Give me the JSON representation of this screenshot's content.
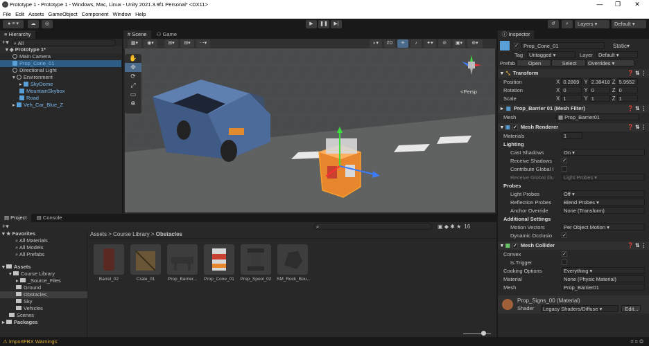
{
  "window": {
    "title": "Prototype 1 - Prototype 1 - Windows, Mac, Linux - Unity 2021.3.9f1 Personal* <DX11>",
    "minimize": "—",
    "restore": "❐",
    "close": "✕"
  },
  "menu": [
    "File",
    "Edit",
    "Assets",
    "GameObject",
    "Component",
    "Window",
    "Help"
  ],
  "toolbar": {
    "play": "▶",
    "pause": "❚❚",
    "step": "▶|",
    "layers": "Layers",
    "layout": "Default"
  },
  "hierarchy": {
    "tab": "Hierarchy",
    "search_placeholder": "All",
    "scene": "Prototype 1*",
    "items": [
      {
        "label": "Main Camera",
        "indent": 1
      },
      {
        "label": "Prop_Cone_01",
        "indent": 1,
        "selected": true
      },
      {
        "label": "Directional Light",
        "indent": 1
      },
      {
        "label": "Environment",
        "indent": 1
      },
      {
        "label": "SkyDome",
        "indent": 2
      },
      {
        "label": "MountainSkybox",
        "indent": 2
      },
      {
        "label": "Road",
        "indent": 2
      },
      {
        "label": "Veh_Car_Blue_Z",
        "indent": 1
      }
    ]
  },
  "scene_view": {
    "tabs": [
      "Scene",
      "Game"
    ],
    "mode_2d": "2D",
    "persp": "<Persp"
  },
  "project": {
    "tabs": [
      "Project",
      "Console"
    ],
    "breadcrumb": [
      "Assets",
      "Course Library",
      "Obstacles"
    ],
    "count": "16",
    "favorites": {
      "label": "Favorites",
      "items": [
        "All Materials",
        "All Models",
        "All Prefabs"
      ]
    },
    "assets_root": "Assets",
    "tree": [
      {
        "label": "Course Library",
        "indent": 1
      },
      {
        "label": "_Source_Files",
        "indent": 2
      },
      {
        "label": "Ground",
        "indent": 2
      },
      {
        "label": "Obstacles",
        "indent": 2,
        "selected": true
      },
      {
        "label": "Sky",
        "indent": 2
      },
      {
        "label": "Vehicles",
        "indent": 2
      },
      {
        "label": "Scenes",
        "indent": 1
      }
    ],
    "packages": "Packages",
    "assets": [
      "Barrel_02",
      "Crate_01",
      "Prop_Barrier...",
      "Prop_Cone_01",
      "Prop_Spool_02",
      "SM_Rock_Bou..."
    ]
  },
  "status": {
    "warning": "ImportFBX Warnings:"
  },
  "inspector": {
    "tab": "Inspector",
    "object_name": "Prop_Cone_01",
    "static": "Static",
    "tag_label": "Tag",
    "tag": "Untagged",
    "layer_label": "Layer",
    "layer": "Default",
    "prefab_label": "Prefab",
    "prefab_open": "Open",
    "prefab_select": "Select",
    "prefab_overrides": "Overrides",
    "transform": {
      "title": "Transform",
      "position": {
        "label": "Position",
        "x": "0.2869",
        "y": "2.38418",
        "z": "5.9552"
      },
      "rotation": {
        "label": "Rotation",
        "x": "0",
        "y": "0",
        "z": "0"
      },
      "scale": {
        "label": "Scale",
        "x": "1",
        "y": "1",
        "z": "1"
      }
    },
    "mesh_filter": {
      "title": "Prop_Barrier 01 (Mesh Filter)",
      "mesh_label": "Mesh",
      "mesh": "Prop_Barrier01"
    },
    "mesh_renderer": {
      "title": "Mesh Renderer",
      "materials_label": "Materials",
      "materials_count": "1",
      "lighting": "Lighting",
      "cast_shadows_label": "Cast Shadows",
      "cast_shadows": "On",
      "receive_shadows_label": "Receive Shadows",
      "contribute_gi_label": "Contribute Global I",
      "receive_gi_label": "Receive Global Illu",
      "receive_gi": "Light Probes",
      "probes": "Probes",
      "light_probes_label": "Light Probes",
      "light_probes": "Off",
      "reflection_probes_label": "Reflection Probes",
      "reflection_probes": "Blend Probes",
      "anchor_override_label": "Anchor Override",
      "anchor_override": "None (Transform)",
      "additional": "Additional Settings",
      "motion_vectors_label": "Motion Vectors",
      "motion_vectors": "Per Object Motion",
      "dynamic_occlusion_label": "Dynamic Occlusio"
    },
    "mesh_collider": {
      "title": "Mesh Collider",
      "convex_label": "Convex",
      "is_trigger_label": "Is Trigger",
      "cooking_label": "Cooking Options",
      "cooking": "Everything",
      "material_label": "Material",
      "material": "None (Physic Material)",
      "mesh_label": "Mesh",
      "mesh": "Prop_Barrier01"
    },
    "material": {
      "title": "Prop_Signs_00 (Material)",
      "shader_label": "Shader",
      "shader": "Legacy Shaders/Diffuse",
      "edit": "Edit..."
    }
  }
}
